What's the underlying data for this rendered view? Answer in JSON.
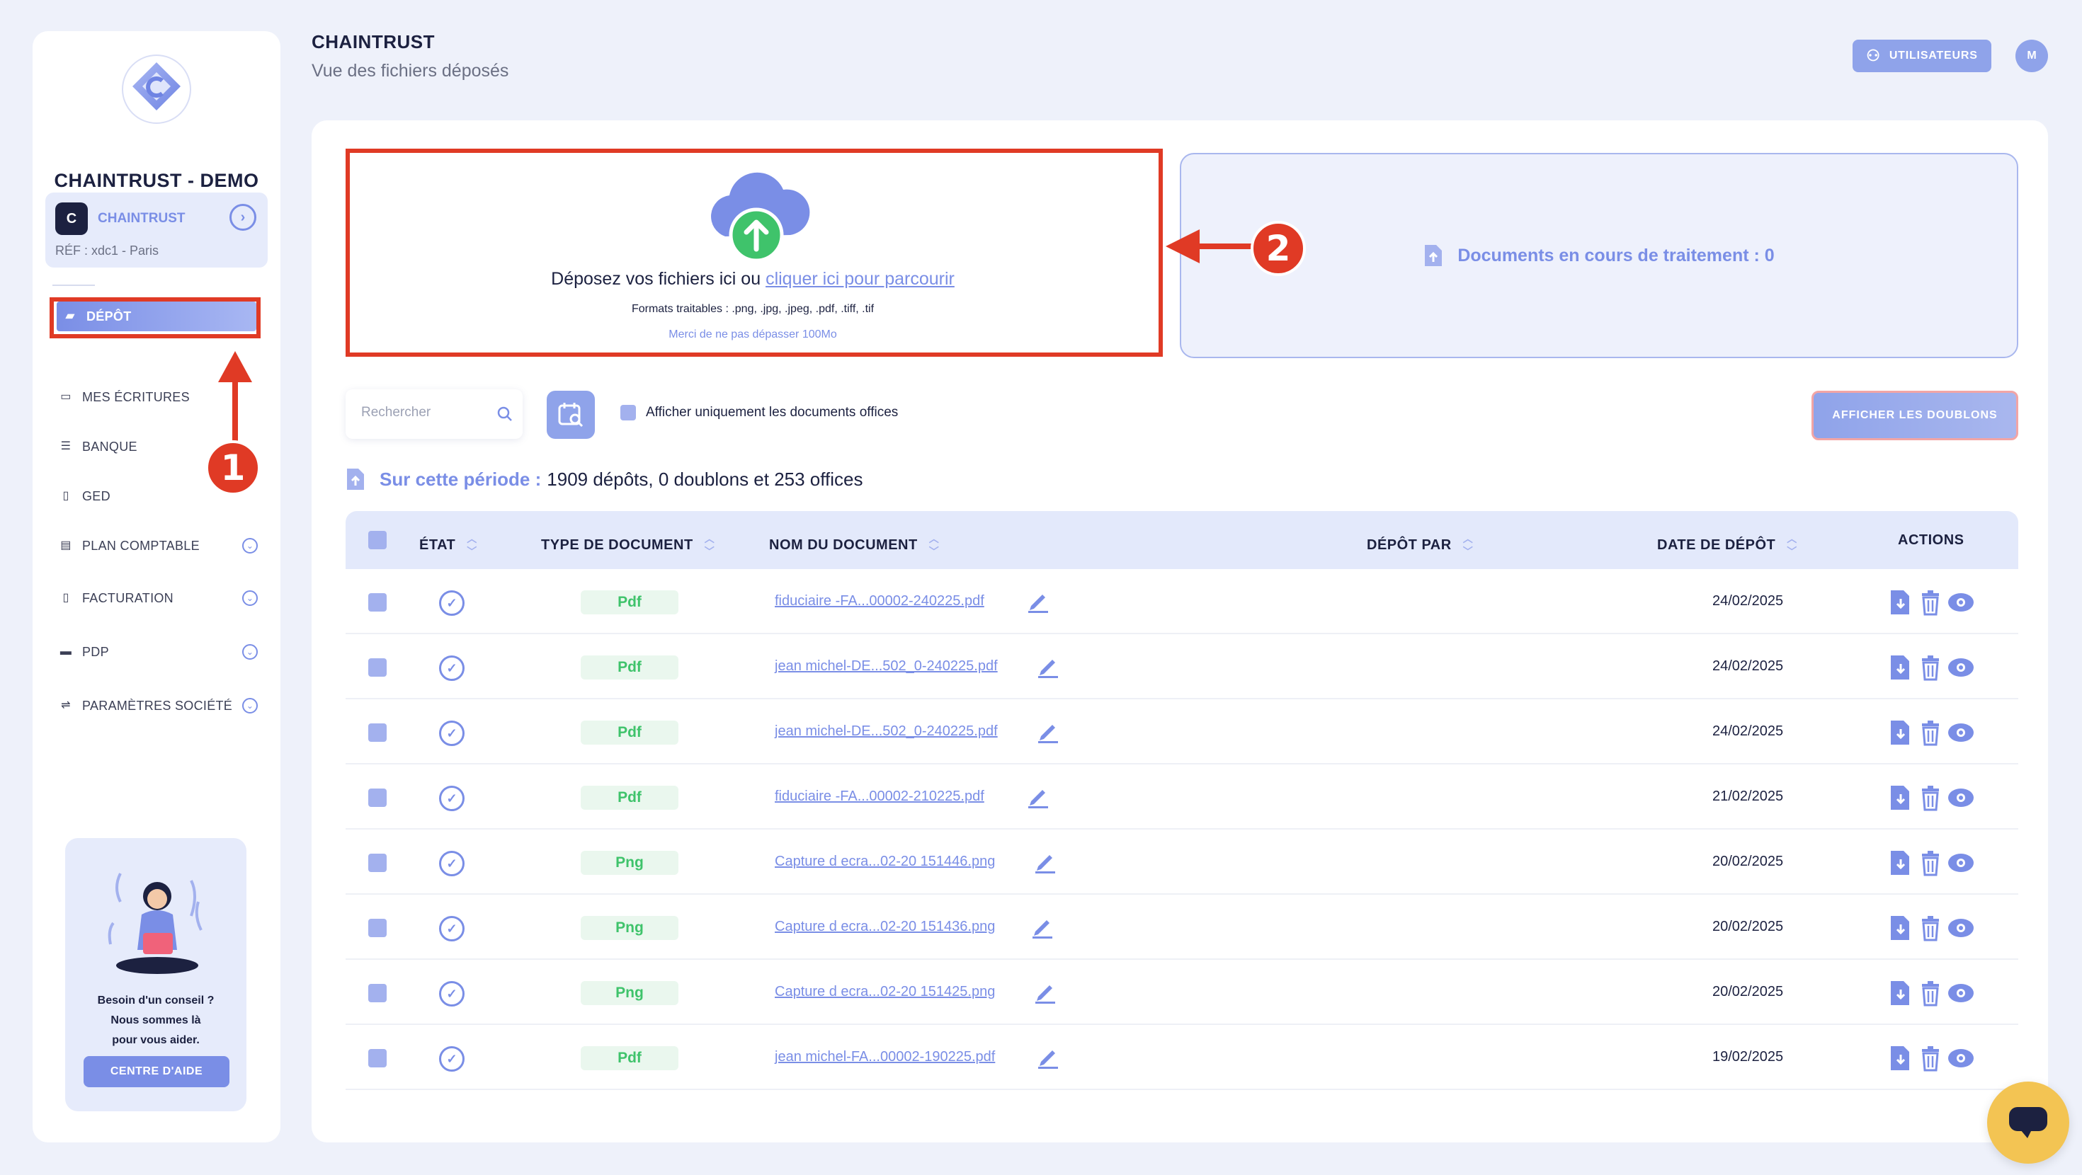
{
  "sidebar": {
    "org_name": "CHAINTRUST - DEMO",
    "company": {
      "badge": "C",
      "name": "CHAINTRUST",
      "ref": "RÉF : xdc1 - Paris"
    },
    "nav": [
      {
        "label": "DÉPÔT",
        "icon": "upload-folder-icon",
        "active": true
      },
      {
        "label": "MES ÉCRITURES",
        "icon": "folder-icon"
      },
      {
        "label": "BANQUE",
        "icon": "bank-icon"
      },
      {
        "label": "GED",
        "icon": "document-icon"
      },
      {
        "label": "PLAN COMPTABLE",
        "icon": "ledger-icon",
        "expandable": true
      },
      {
        "label": "FACTURATION",
        "icon": "invoice-icon",
        "expandable": true
      },
      {
        "label": "PDP",
        "icon": "card-icon",
        "expandable": true
      },
      {
        "label": "PARAMÈTRES SOCIÉTÉ",
        "icon": "settings-sliders-icon",
        "expandable": true
      }
    ],
    "help": {
      "line1": "Besoin d'un conseil ?",
      "line2": "Nous sommes là",
      "line3": "pour vous aider.",
      "button": "CENTRE D'AIDE"
    }
  },
  "header": {
    "title": "CHAINTRUST",
    "subtitle": "Vue des fichiers déposés",
    "users_button": "UTILISATEURS",
    "avatar": "M"
  },
  "dropzone": {
    "text": "Déposez vos fichiers ici ou ",
    "link": "cliquer ici pour parcourir",
    "formats": "Formats traitables : .png, .jpg, .jpeg, .pdf, .tiff, .tif",
    "limit": "Merci de ne pas dépasser 100Mo"
  },
  "processing": {
    "label": "Documents en cours de traitement : 0"
  },
  "toolbar": {
    "search_placeholder": "Rechercher",
    "only_offices": "Afficher uniquement les documents offices",
    "duplicates_button": "AFFICHER LES DOUBLONS"
  },
  "period": {
    "label": "Sur cette période :",
    "summary": "1909 dépôts, 0 doublons et 253 offices"
  },
  "table": {
    "columns": [
      "ÉTAT",
      "TYPE DE DOCUMENT",
      "NOM DU DOCUMENT",
      "DÉPÔT PAR",
      "DATE DE DÉPÔT",
      "ACTIONS"
    ],
    "rows": [
      {
        "type": "Pdf",
        "name": "fiduciaire -FA...00002-240225.pdf",
        "by": "",
        "date": "24/02/2025"
      },
      {
        "type": "Pdf",
        "name": "jean michel-DE...502_0-240225.pdf",
        "by": "",
        "date": "24/02/2025"
      },
      {
        "type": "Pdf",
        "name": "jean michel-DE...502_0-240225.pdf",
        "by": "",
        "date": "24/02/2025"
      },
      {
        "type": "Pdf",
        "name": "fiduciaire -FA...00002-210225.pdf",
        "by": "",
        "date": "21/02/2025"
      },
      {
        "type": "Png",
        "name": "Capture d ecra...02-20 151446.png",
        "by": "",
        "date": "20/02/2025"
      },
      {
        "type": "Png",
        "name": "Capture d ecra...02-20 151436.png",
        "by": "",
        "date": "20/02/2025"
      },
      {
        "type": "Png",
        "name": "Capture d ecra...02-20 151425.png",
        "by": "",
        "date": "20/02/2025"
      },
      {
        "type": "Pdf",
        "name": "jean michel-FA...00002-190225.pdf",
        "by": "",
        "date": "19/02/2025"
      }
    ]
  },
  "annotations": {
    "badge1": "1",
    "badge2": "2"
  },
  "colors": {
    "accent": "#7a8ee6",
    "highlight": "#e03a25",
    "success": "#3fc36b",
    "chat": "#f3c453"
  }
}
